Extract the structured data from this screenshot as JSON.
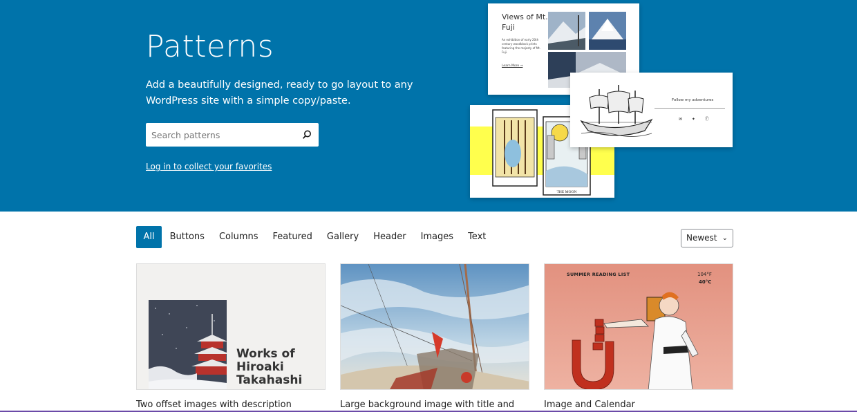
{
  "hero": {
    "title": "Patterns",
    "description": "Add a beautifully designed, ready to go layout to any WordPress site with a simple copy/paste.",
    "search_placeholder": "Search patterns",
    "login_link": "Log in to collect your favorites"
  },
  "collage": {
    "fuji": {
      "title": "Views of Mt. Fuji",
      "text": "An exhibition of early 20th century woodblock prints featuring the majesty of Mt. Fuji.",
      "link": "Learn More →"
    },
    "ship": {
      "follow": "Follow my adventures",
      "icons": "✉ ✦ ⓕ"
    }
  },
  "filters": [
    "All",
    "Buttons",
    "Columns",
    "Featured",
    "Gallery",
    "Header",
    "Images",
    "Text"
  ],
  "active_filter": "All",
  "sort": {
    "selected": "Newest"
  },
  "cards": [
    {
      "caption": "Two offset images with description",
      "overlay_title": "Works of Hiroaki Takahashi"
    },
    {
      "caption": "Large background image with title and"
    },
    {
      "caption": "Image and Calendar",
      "overlay_title": "SUMMER READING LIST",
      "temp_f": "104°F",
      "temp_c": "40°C"
    }
  ],
  "colors": {
    "brand": "#0073aa",
    "hero_bg": "#0073aa",
    "tarot_yellow": "#ffff4d"
  }
}
